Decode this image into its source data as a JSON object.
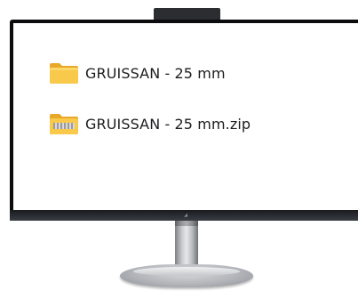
{
  "files": [
    {
      "name": "GRUISSAN - 25 mm",
      "icon": "folder-icon",
      "type": "folder"
    },
    {
      "name": "GRUISSAN - 25 mm.zip",
      "icon": "zip-folder-icon",
      "type": "zip"
    }
  ],
  "colors": {
    "folder_yellow": "#f8c94a",
    "folder_dark": "#e8a92a",
    "zip_stripe": "#d9d9d9",
    "bezel": "#0c0c0e",
    "text": "#1d1d1f"
  }
}
